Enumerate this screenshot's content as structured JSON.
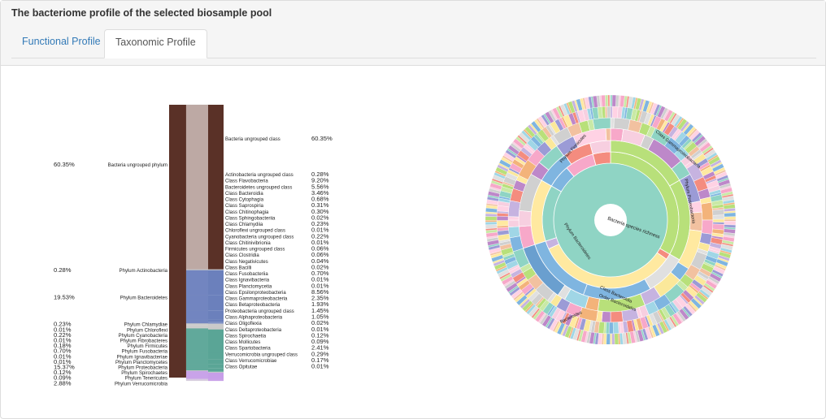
{
  "panel": {
    "title": "The bacteriome profile of the selected biosample pool"
  },
  "tabs": [
    {
      "label": "Functional Profile",
      "active": false
    },
    {
      "label": "Taxonomic Profile",
      "active": true
    }
  ],
  "colors": {
    "link": "#337ab7",
    "kingdom": "#5a3127",
    "ungrouped_phylum": "#bda9a4",
    "bacteroidetes": "#6b80bc",
    "proteobacteria": "#5aa596",
    "verrucomicrobia": "#c79ee8",
    "thin_link": "#c8c8c8"
  },
  "chart_data": [
    {
      "type": "sankey",
      "phyla": [
        {
          "name": "Bacteria ungrouped phylum",
          "percent": "60.35%",
          "value": 60.35,
          "color": "#bda9a4"
        },
        {
          "name": "Phylum Actinobacteria",
          "percent": "0.28%",
          "value": 0.28,
          "color": "#c8c8c8"
        },
        {
          "name": "Phylum Bacteroidetes",
          "percent": "19.53%",
          "value": 19.53,
          "color": "#6b80bc"
        },
        {
          "name": "Phylum Chlamydiae",
          "percent": "0.23%",
          "value": 0.23,
          "color": "#c8c8c8"
        },
        {
          "name": "Phylum Chloroflexi",
          "percent": "0.01%",
          "value": 0.01,
          "color": "#c8c8c8"
        },
        {
          "name": "Phylum Cyanobacteria",
          "percent": "0.22%",
          "value": 0.22,
          "color": "#c8c8c8"
        },
        {
          "name": "Phylum Fibrobacteres",
          "percent": "0.01%",
          "value": 0.01,
          "color": "#c8c8c8"
        },
        {
          "name": "Phylum Firmicutes",
          "percent": "0.18%",
          "value": 0.18,
          "color": "#c8c8c8"
        },
        {
          "name": "Phylum Fusobacteria",
          "percent": "0.70%",
          "value": 0.7,
          "color": "#c8c8c8"
        },
        {
          "name": "Phylum Ignavibacteriae",
          "percent": "0.01%",
          "value": 0.01,
          "color": "#c8c8c8"
        },
        {
          "name": "Phylum Planctomycetes",
          "percent": "0.01%",
          "value": 0.01,
          "color": "#c8c8c8"
        },
        {
          "name": "Phylum Proteobacteria",
          "percent": "15.37%",
          "value": 15.37,
          "color": "#5aa596"
        },
        {
          "name": "Phylum Spirochaetes",
          "percent": "0.12%",
          "value": 0.12,
          "color": "#c8c8c8"
        },
        {
          "name": "Phylum Tenericutes",
          "percent": "0.09%",
          "value": 0.09,
          "color": "#c8c8c8"
        },
        {
          "name": "Phylum Verrucomicrobia",
          "percent": "2.88%",
          "value": 2.88,
          "color": "#c79ee8"
        }
      ],
      "classes": [
        {
          "name": "Bacteria ungrouped class",
          "percent": "60.35%",
          "value": 60.35,
          "phylum": 0
        },
        {
          "name": "Actinobacteria ungrouped class",
          "percent": "0.28%",
          "value": 0.28,
          "phylum": 1
        },
        {
          "name": "Class Flavobacteria",
          "percent": "9.20%",
          "value": 9.2,
          "phylum": 2
        },
        {
          "name": "Bacteroidetes ungrouped class",
          "percent": "5.56%",
          "value": 5.56,
          "phylum": 2
        },
        {
          "name": "Class Bacteroidia",
          "percent": "3.46%",
          "value": 3.46,
          "phylum": 2
        },
        {
          "name": "Class Cytophagia",
          "percent": "0.68%",
          "value": 0.68,
          "phylum": 2
        },
        {
          "name": "Class Saprospiria",
          "percent": "0.31%",
          "value": 0.31,
          "phylum": 2
        },
        {
          "name": "Class Chitinophagia",
          "percent": "0.30%",
          "value": 0.3,
          "phylum": 2
        },
        {
          "name": "Class Sphingobacteriia",
          "percent": "0.02%",
          "value": 0.02,
          "phylum": 2
        },
        {
          "name": "Class Chlamydiia",
          "percent": "0.23%",
          "value": 0.23,
          "phylum": 3
        },
        {
          "name": "Chloroflexi ungrouped class",
          "percent": "0.01%",
          "value": 0.01,
          "phylum": 4
        },
        {
          "name": "Cyanobacteria ungrouped class",
          "percent": "0.22%",
          "value": 0.22,
          "phylum": 5
        },
        {
          "name": "Class Chitinivibrionia",
          "percent": "0.01%",
          "value": 0.01,
          "phylum": 6
        },
        {
          "name": "Firmicutes ungrouped class",
          "percent": "0.06%",
          "value": 0.06,
          "phylum": 7
        },
        {
          "name": "Class Clostridia",
          "percent": "0.06%",
          "value": 0.06,
          "phylum": 7
        },
        {
          "name": "Class Negativicutes",
          "percent": "0.04%",
          "value": 0.04,
          "phylum": 7
        },
        {
          "name": "Class Bacilli",
          "percent": "0.02%",
          "value": 0.02,
          "phylum": 7
        },
        {
          "name": "Class Fusobacteriia",
          "percent": "0.70%",
          "value": 0.7,
          "phylum": 8
        },
        {
          "name": "Class Ignavibacteria",
          "percent": "0.01%",
          "value": 0.01,
          "phylum": 9
        },
        {
          "name": "Class Planctomycetia",
          "percent": "0.01%",
          "value": 0.01,
          "phylum": 10
        },
        {
          "name": "Class Epsilonproteobacteria",
          "percent": "8.56%",
          "value": 8.56,
          "phylum": 11
        },
        {
          "name": "Class Gammaproteobacteria",
          "percent": "2.35%",
          "value": 2.35,
          "phylum": 11
        },
        {
          "name": "Class Betaproteobacteria",
          "percent": "1.93%",
          "value": 1.93,
          "phylum": 11
        },
        {
          "name": "Proteobacteria ungrouped class",
          "percent": "1.45%",
          "value": 1.45,
          "phylum": 11
        },
        {
          "name": "Class Alphaproteobacteria",
          "percent": "1.05%",
          "value": 1.05,
          "phylum": 11
        },
        {
          "name": "Class Oligoflexia",
          "percent": "0.02%",
          "value": 0.02,
          "phylum": 11
        },
        {
          "name": "Class Deltaproteobacteria",
          "percent": "0.01%",
          "value": 0.01,
          "phylum": 11
        },
        {
          "name": "Class Spirochaetia",
          "percent": "0.12%",
          "value": 0.12,
          "phylum": 12
        },
        {
          "name": "Class Mollicutes",
          "percent": "0.09%",
          "value": 0.09,
          "phylum": 13
        },
        {
          "name": "Class Spartobacteria",
          "percent": "2.41%",
          "value": 2.41,
          "phylum": 14
        },
        {
          "name": "Verrucomicrobia ungrouped class",
          "percent": "0.29%",
          "value": 0.29,
          "phylum": 14
        },
        {
          "name": "Class Verrucomicrobiae",
          "percent": "0.17%",
          "value": 0.17,
          "phylum": 14
        },
        {
          "name": "Class Opitutae",
          "percent": "0.01%",
          "value": 0.01,
          "phylum": 14
        }
      ]
    },
    {
      "type": "sunburst",
      "center_label": "Bacteria species richness",
      "ring_labels": [
        "Phylum Firmicutes",
        "Class Gammaproteobacteria",
        "Phylum Proteobacteria",
        "Phylum Bacteroidetes",
        "Class Bacteroidia",
        "Order Bacteroidales",
        "Bacteroides"
      ],
      "palette": [
        "#f7a8c9",
        "#c6b3e0",
        "#8fd4c4",
        "#e0e0e0",
        "#ffe9a0",
        "#f7cfe0",
        "#b8e07a",
        "#9b9bd6",
        "#f48c7f",
        "#7fb5e0",
        "#d0d0d0",
        "#f3b37a",
        "#ffd2e4",
        "#c9e9a6",
        "#fbe89a",
        "#bd88c9",
        "#a0d6e6",
        "#f2c1a0"
      ]
    }
  ]
}
